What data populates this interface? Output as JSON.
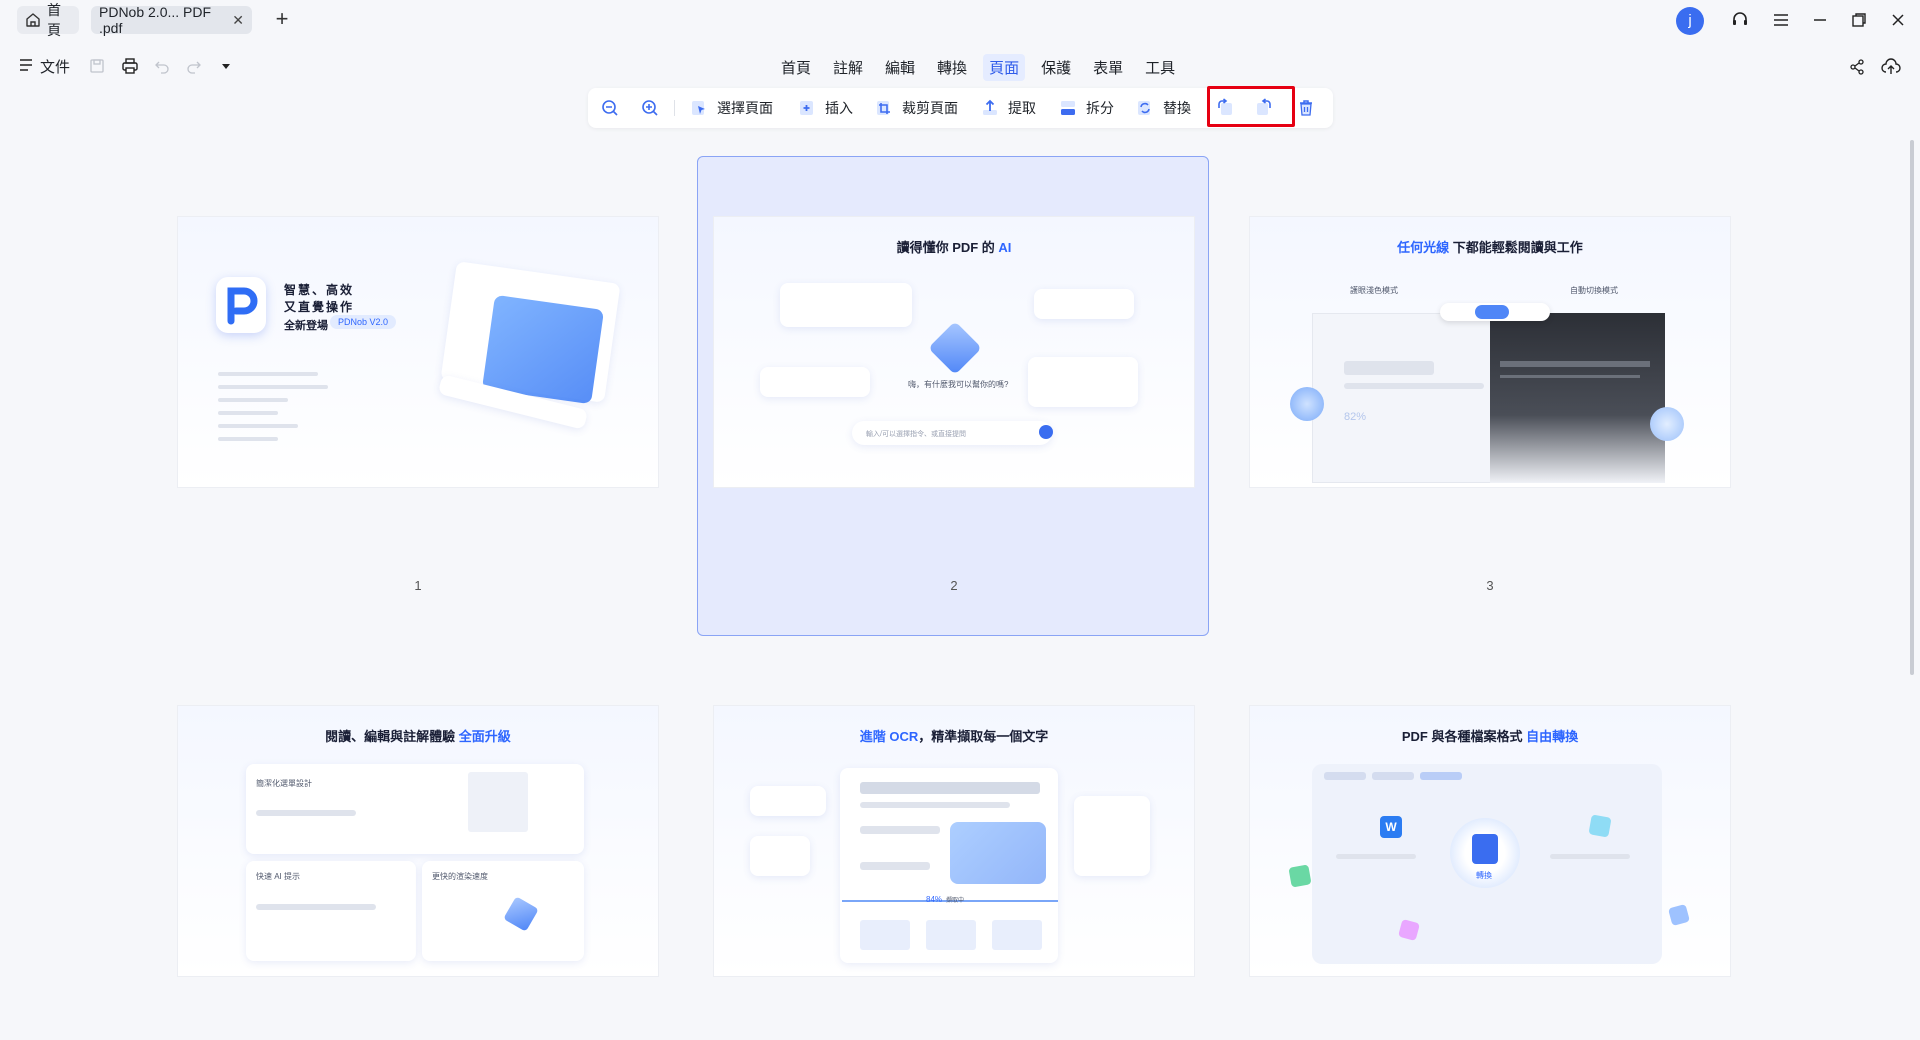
{
  "tabs": {
    "home_label": "首頁",
    "doc_label": "PDNob 2.0... PDF .pdf"
  },
  "user": {
    "avatar_letter": "j"
  },
  "menubar": {
    "file_label": "文件",
    "tabs": [
      "首頁",
      "註解",
      "編輯",
      "轉換",
      "頁面",
      "保護",
      "表單",
      "工具"
    ],
    "active_tab": "頁面"
  },
  "toolbar": {
    "select_pages": "選擇頁面",
    "insert": "插入",
    "crop_page": "裁剪頁面",
    "extract": "提取",
    "split": "拆分",
    "replace": "替換"
  },
  "pages": [
    {
      "number": "1",
      "tagline_1": "智慧、高效",
      "tagline_2": "又直覺操作",
      "launch": "全新登場",
      "version": "PDNob V2.0"
    },
    {
      "number": "2",
      "title_pre": "讀得懂你 PDF 的 ",
      "title_acc": "AI",
      "prompt": "嗨，有什麼我可以幫你的嗎?",
      "input_placeholder": "輸入/可以選擇指令、或直接提問"
    },
    {
      "number": "3",
      "title_acc": "任何光線",
      "title_post": " 下都能輕鬆閱讀與工作",
      "light_mode": "護眼淺色模式",
      "auto_mode": "自動切換模式",
      "percent": "82%"
    },
    {
      "title_pre": "閱讀、編輯與註解體驗 ",
      "title_acc": "全面升級",
      "label_a": "簡潔化選單設計",
      "label_b": "快速 AI 提示",
      "label_c": "更快的渲染速度"
    },
    {
      "title_acc": "進階 OCR",
      "title_post": "，精準擷取每一個文字",
      "percent": "84%",
      "status": "擷取中"
    },
    {
      "title_pre": "PDF 與各種檔案格式 ",
      "title_acc": "自由轉換",
      "center_label": "轉換"
    }
  ],
  "colors": {
    "accent": "#2f5bea",
    "highlight_border": "#e60012",
    "selected_bg": "#e5eafd"
  }
}
